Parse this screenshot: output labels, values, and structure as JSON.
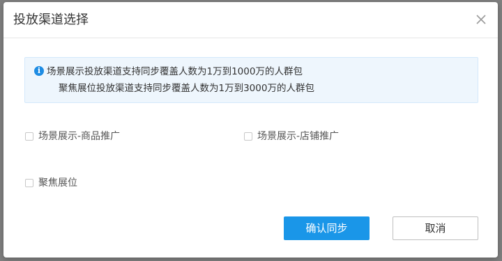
{
  "dialog": {
    "title": "投放渠道选择",
    "close_icon": "close-icon"
  },
  "notice": {
    "icon": "info-icon",
    "icon_glyph": "i",
    "line1": "场景展示投放渠道支持同步覆盖人数为1万到1000万的人群包",
    "line2": "聚焦展位投放渠道支持同步覆盖人数为1万到3000万的人群包"
  },
  "options": [
    {
      "label": "场景展示-商品推广",
      "checked": false
    },
    {
      "label": "场景展示-店铺推广",
      "checked": false
    },
    {
      "label": "聚焦展位",
      "checked": false
    }
  ],
  "buttons": {
    "confirm_label": "确认同步",
    "cancel_label": "取消"
  },
  "colors": {
    "primary": "#1a96e8",
    "notice_bg": "#eef6fd",
    "notice_border": "#d3e8fb",
    "info_icon": "#1e8ce3"
  }
}
